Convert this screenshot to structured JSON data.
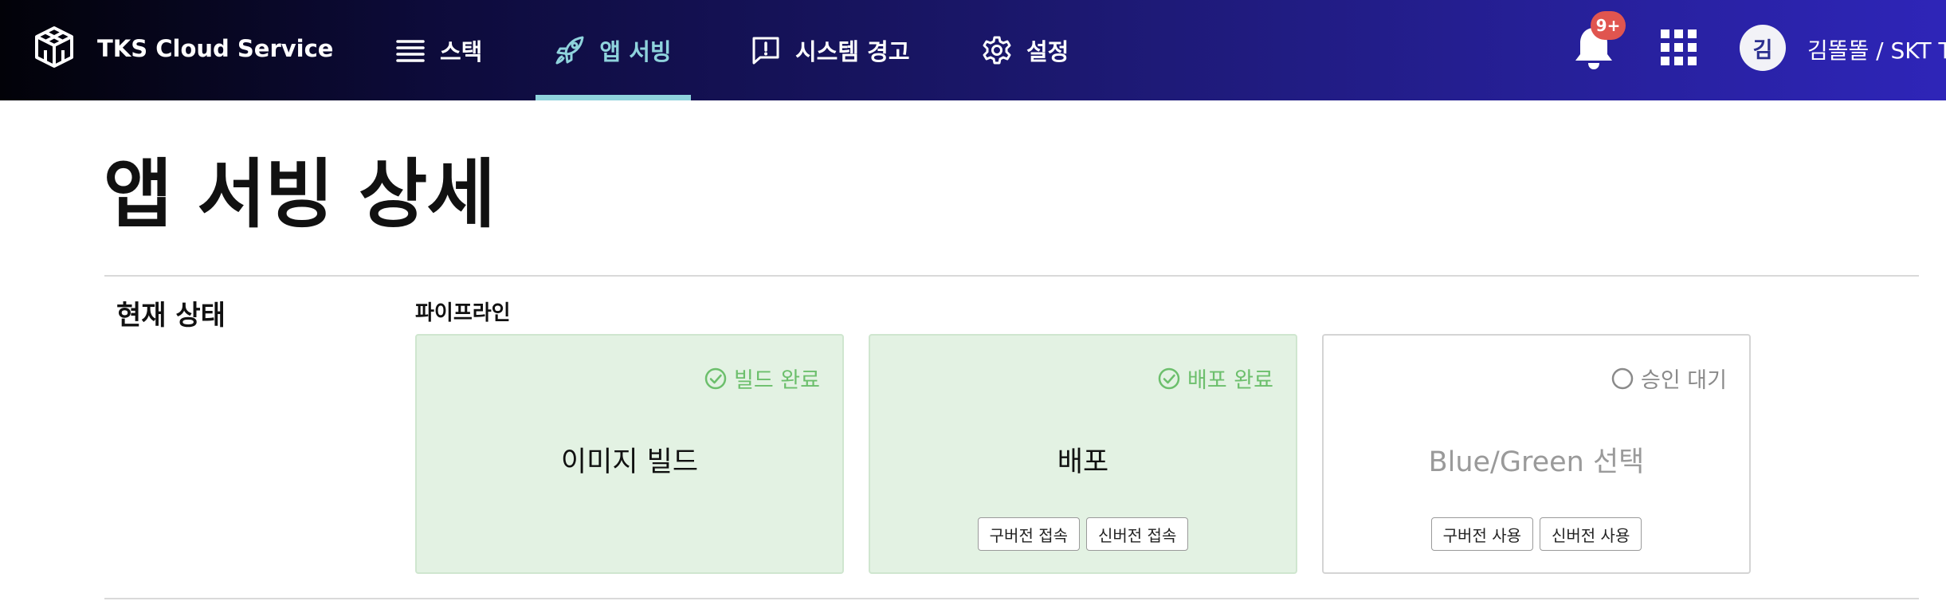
{
  "header": {
    "brand": "TKS Cloud Service",
    "nav": [
      {
        "label": "스택",
        "icon": "list-icon"
      },
      {
        "label": "앱 서빙",
        "icon": "rocket-icon",
        "active": true
      },
      {
        "label": "시스템 경고",
        "icon": "alert-message-icon"
      },
      {
        "label": "설정",
        "icon": "gear-icon"
      }
    ],
    "notification_badge": "9+",
    "avatar_initial": "김",
    "user_label": "김똘똘 / SKT T"
  },
  "page": {
    "title": "앱 서빙 상세",
    "section_label": "현재 상태",
    "pipeline_label": "파이프라인"
  },
  "pipeline": [
    {
      "status": "빌드 완료",
      "title": "이미지 빌드",
      "state": "done",
      "buttons": []
    },
    {
      "status": "배포 완료",
      "title": "배포",
      "state": "done",
      "buttons": [
        "구버전 접속",
        "신버전 접속"
      ]
    },
    {
      "status": "승인 대기",
      "title": "Blue/Green 선택",
      "state": "pending",
      "buttons": [
        "구버전 사용",
        "신버전 사용"
      ]
    }
  ],
  "colors": {
    "accent": "#8fd3dc",
    "success": "#6cbf6c",
    "success_bg": "#e3f2e3",
    "badge": "#e0554f",
    "header_start": "#020208",
    "header_end": "#2e25b8"
  }
}
